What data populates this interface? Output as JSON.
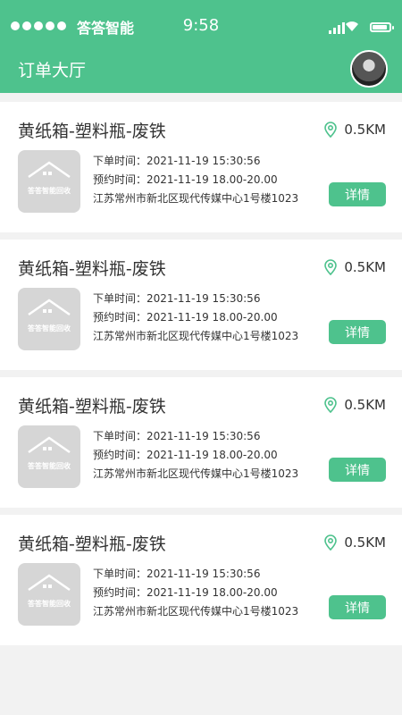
{
  "status_bar": {
    "carrier": "答答智能",
    "time": "9:58"
  },
  "header": {
    "title": "订单大厅"
  },
  "orders": [
    {
      "title": "黄纸箱-塑料瓶-废铁",
      "distance": "0.5KM",
      "logo_text": "答答智能回收",
      "order_time": "下单时间：2021-11-19  15:30:56",
      "appointment_time": "预约时间：2021-11-19 18.00-20.00",
      "address": "江苏常州市新北区现代传媒中心1号楼1023",
      "detail_label": "详情"
    },
    {
      "title": "黄纸箱-塑料瓶-废铁",
      "distance": "0.5KM",
      "logo_text": "答答智能回收",
      "order_time": "下单时间：2021-11-19  15:30:56",
      "appointment_time": "预约时间：2021-11-19 18.00-20.00",
      "address": "江苏常州市新北区现代传媒中心1号楼1023",
      "detail_label": "详情"
    },
    {
      "title": "黄纸箱-塑料瓶-废铁",
      "distance": "0.5KM",
      "logo_text": "答答智能回收",
      "order_time": "下单时间：2021-11-19  15:30:56",
      "appointment_time": "预约时间：2021-11-19 18.00-20.00",
      "address": "江苏常州市新北区现代传媒中心1号楼1023",
      "detail_label": "详情"
    },
    {
      "title": "黄纸箱-塑料瓶-废铁",
      "distance": "0.5KM",
      "logo_text": "答答智能回收",
      "order_time": "下单时间：2021-11-19  15:30:56",
      "appointment_time": "预约时间：2021-11-19 18.00-20.00",
      "address": "江苏常州市新北区现代传媒中心1号楼1023",
      "detail_label": "详情"
    }
  ],
  "colors": {
    "accent": "#4ec28d",
    "background": "#f2f2f2",
    "thumb": "#d6d6d6"
  },
  "icons": {
    "location": "location-pin-icon",
    "signal": "signal-icon",
    "wifi": "wifi-icon",
    "battery": "battery-icon"
  }
}
